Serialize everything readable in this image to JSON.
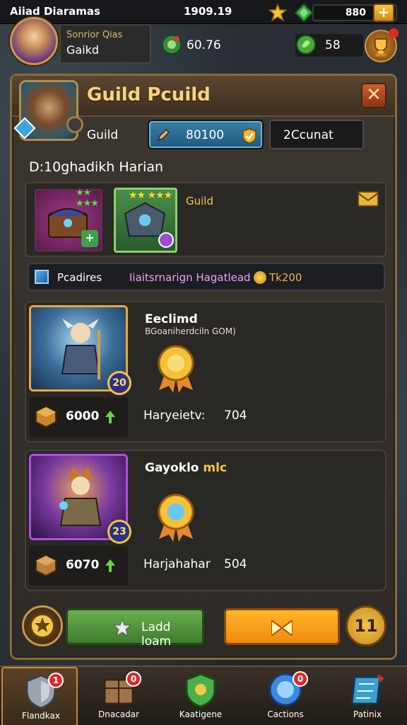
{
  "status_bar": {
    "title": "Aiiad Diaramas",
    "clock": "1909.19",
    "currency": "880",
    "plus": "+"
  },
  "profile": {
    "rank": "Sonrior Qias",
    "name": "Gaikd",
    "stat1": "60.76",
    "stat2": "58"
  },
  "panel": {
    "title": "Guild Pcuild",
    "close": "✕",
    "guild_label": "Guild",
    "guild_value": "80100",
    "count_value": "2Ccunat",
    "description": "D:10ghadikh Harian"
  },
  "rewards": {
    "label": "Guild",
    "stars": "★★ ★★★",
    "plus": "+"
  },
  "info_strip": {
    "label": "Pcadires",
    "name": "Iiaitsrnarign Hagatlead",
    "value": "Tk200"
  },
  "members": [
    {
      "name": "Eeclimd",
      "subtitle": "BGoaniherdciln GOM)",
      "level": "20",
      "power": "6000",
      "stat_label": "Haryeietv:",
      "stat_value": "704"
    },
    {
      "name": "Gayoklo",
      "name_suffix": "mlc",
      "level": "23",
      "power": "6070",
      "stat_label": "Harjahahar",
      "stat_value": "504"
    }
  ],
  "actions": {
    "primary_label": "Ladd loam",
    "count_label": "11"
  },
  "bottom_nav": [
    {
      "label": "Flandkax",
      "badge": "1"
    },
    {
      "label": "Dnacadar",
      "badge": "0"
    },
    {
      "label": "Kaatigene",
      "badge": ""
    },
    {
      "label": "Cactions",
      "badge": "0"
    },
    {
      "label": "Patinix",
      "badge": ""
    }
  ],
  "colors": {
    "accent_gold": "#f6d47e",
    "button_green": "#6cae50",
    "button_orange": "#ffb52a",
    "badge_red": "#d92a2a"
  }
}
